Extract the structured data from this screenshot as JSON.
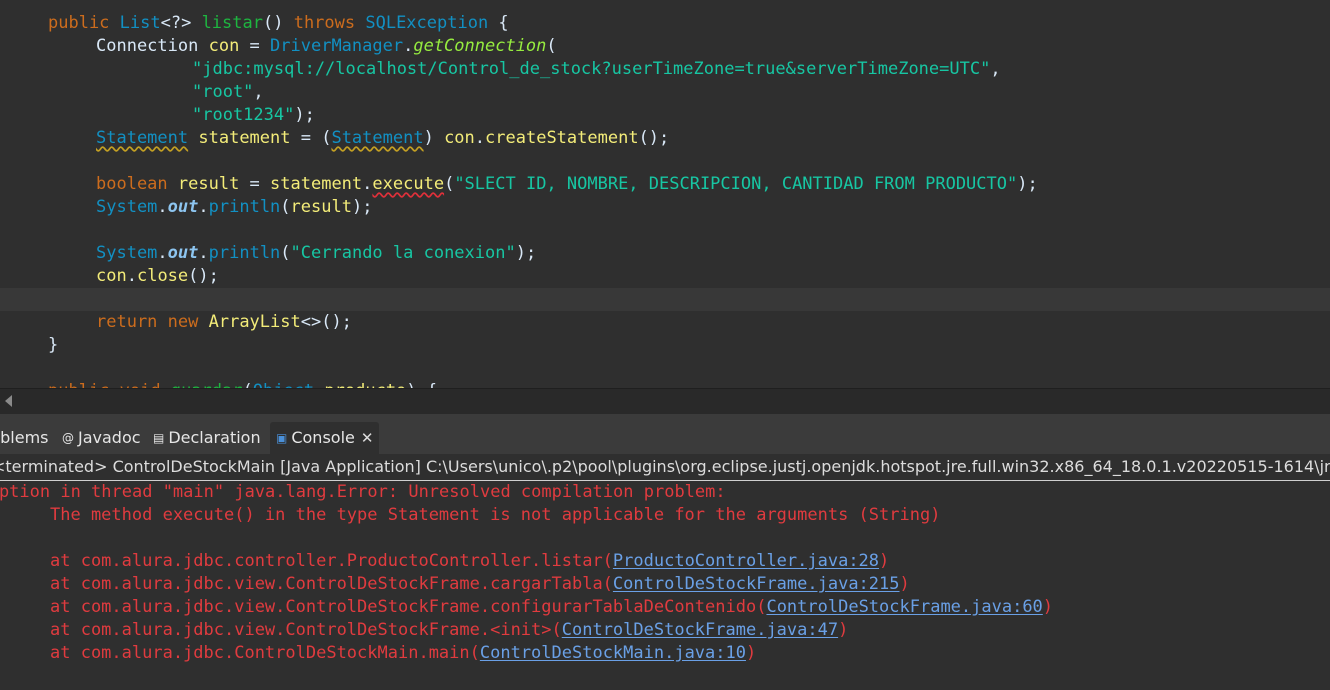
{
  "editor": {
    "lines": [
      {
        "segments": [
          [
            "kw",
            "public "
          ],
          [
            "type",
            "List"
          ],
          [
            "plain",
            "<?> "
          ],
          [
            "meth2",
            "listar"
          ],
          [
            "plain",
            "() "
          ],
          [
            "kw",
            "throws "
          ],
          [
            "type",
            "SQLException"
          ],
          [
            "plain",
            " {"
          ]
        ]
      },
      {
        "segments": [
          [
            "plain",
            "Connection "
          ],
          [
            "var",
            "con"
          ],
          [
            "plain",
            " = "
          ],
          [
            "type",
            "DriverManager"
          ],
          [
            "plain",
            "."
          ],
          [
            "it",
            "getConnection"
          ],
          [
            "plain",
            "("
          ]
        ]
      },
      {
        "segments": [
          [
            "str",
            "\"jdbc:mysql://localhost/Control_de_stock?userTimeZone=true&serverTimeZone=UTC\""
          ],
          [
            "plain",
            ","
          ]
        ]
      },
      {
        "segments": [
          [
            "str",
            "\"root\""
          ],
          [
            "plain",
            ","
          ]
        ]
      },
      {
        "segments": [
          [
            "str",
            "\"root1234\""
          ],
          [
            "plain",
            ");"
          ]
        ]
      },
      {
        "segments": [
          [
            "warnType",
            "Statement"
          ],
          [
            "plain",
            " "
          ],
          [
            "var",
            "statement"
          ],
          [
            "plain",
            " = ("
          ],
          [
            "warnType",
            "Statement"
          ],
          [
            "plain",
            ") "
          ],
          [
            "var",
            "con"
          ],
          [
            "plain",
            "."
          ],
          [
            "var",
            "createStatement"
          ],
          [
            "plain",
            "();"
          ]
        ]
      },
      {
        "segments": []
      },
      {
        "segments": [
          [
            "kw",
            "boolean "
          ],
          [
            "var",
            "result"
          ],
          [
            "plain",
            " = "
          ],
          [
            "var",
            "statement"
          ],
          [
            "plain",
            "."
          ],
          [
            "errMeth",
            "execute"
          ],
          [
            "plain",
            "("
          ],
          [
            "str",
            "\"SLECT ID, NOMBRE, DESCRIPCION, CANTIDAD FROM PRODUCTO\""
          ],
          [
            "plain",
            ");"
          ]
        ]
      },
      {
        "segments": [
          [
            "type",
            "System"
          ],
          [
            "plain",
            "."
          ],
          [
            "static",
            "out"
          ],
          [
            "plain",
            "."
          ],
          [
            "type",
            "println"
          ],
          [
            "plain",
            "("
          ],
          [
            "var",
            "result"
          ],
          [
            "plain",
            ");"
          ]
        ]
      },
      {
        "segments": []
      },
      {
        "segments": [
          [
            "type",
            "System"
          ],
          [
            "plain",
            "."
          ],
          [
            "static",
            "out"
          ],
          [
            "plain",
            "."
          ],
          [
            "type",
            "println"
          ],
          [
            "plain",
            "("
          ],
          [
            "str",
            "\"Cerrando la conexion\""
          ],
          [
            "plain",
            ");"
          ]
        ]
      },
      {
        "segments": [
          [
            "var",
            "con"
          ],
          [
            "plain",
            "."
          ],
          [
            "var",
            "close"
          ],
          [
            "plain",
            "();"
          ]
        ]
      },
      {
        "segments": []
      },
      {
        "segments": [
          [
            "kw",
            "return "
          ],
          [
            "kw",
            "new "
          ],
          [
            "var",
            "ArrayList"
          ],
          [
            "plain",
            "<>();"
          ]
        ]
      },
      {
        "segments": [
          [
            "plain",
            "}"
          ]
        ]
      },
      {
        "segments": []
      },
      {
        "segments": [
          [
            "kw",
            "public void "
          ],
          [
            "meth2",
            "guardar"
          ],
          [
            "plain",
            "("
          ],
          [
            "type",
            "Object"
          ],
          [
            "plain",
            " "
          ],
          [
            "var",
            "producto"
          ],
          [
            "plain",
            ") {"
          ]
        ]
      }
    ]
  },
  "tabs": [
    {
      "label": "Problems",
      "icon": "problems-icon"
    },
    {
      "label": "Javadoc",
      "icon": "javadoc-icon"
    },
    {
      "label": "Declaration",
      "icon": "declaration-icon"
    },
    {
      "label": "Console",
      "icon": "console-icon",
      "active": true
    }
  ],
  "console": {
    "header": "<terminated> ControlDeStockMain [Java Application] C:\\Users\\unico\\.p2\\pool\\plugins\\org.eclipse.justj.openjdk.hotspot.jre.full.win32.x86_64_18.0.1.v20220515-1614\\jre\\bin\\javaw.exe",
    "exception": "Exception in thread \"main\" java.lang.Error: Unresolved compilation problem: ",
    "message": "The method execute() in the type Statement is not applicable for the arguments (String)",
    "stack": [
      {
        "at": "at com.alura.jdbc.controller.ProductoController.listar(",
        "link": "ProductoController.java:28",
        "end": ")"
      },
      {
        "at": "at com.alura.jdbc.view.ControlDeStockFrame.cargarTabla(",
        "link": "ControlDeStockFrame.java:215",
        "end": ")"
      },
      {
        "at": "at com.alura.jdbc.view.ControlDeStockFrame.configurarTablaDeContenido(",
        "link": "ControlDeStockFrame.java:60",
        "end": ")"
      },
      {
        "at": "at com.alura.jdbc.view.ControlDeStockFrame.<init>(",
        "link": "ControlDeStockFrame.java:47",
        "end": ")"
      },
      {
        "at": "at com.alura.jdbc.ControlDeStockMain.main(",
        "link": "ControlDeStockMain.java:10",
        "end": ")"
      }
    ]
  }
}
